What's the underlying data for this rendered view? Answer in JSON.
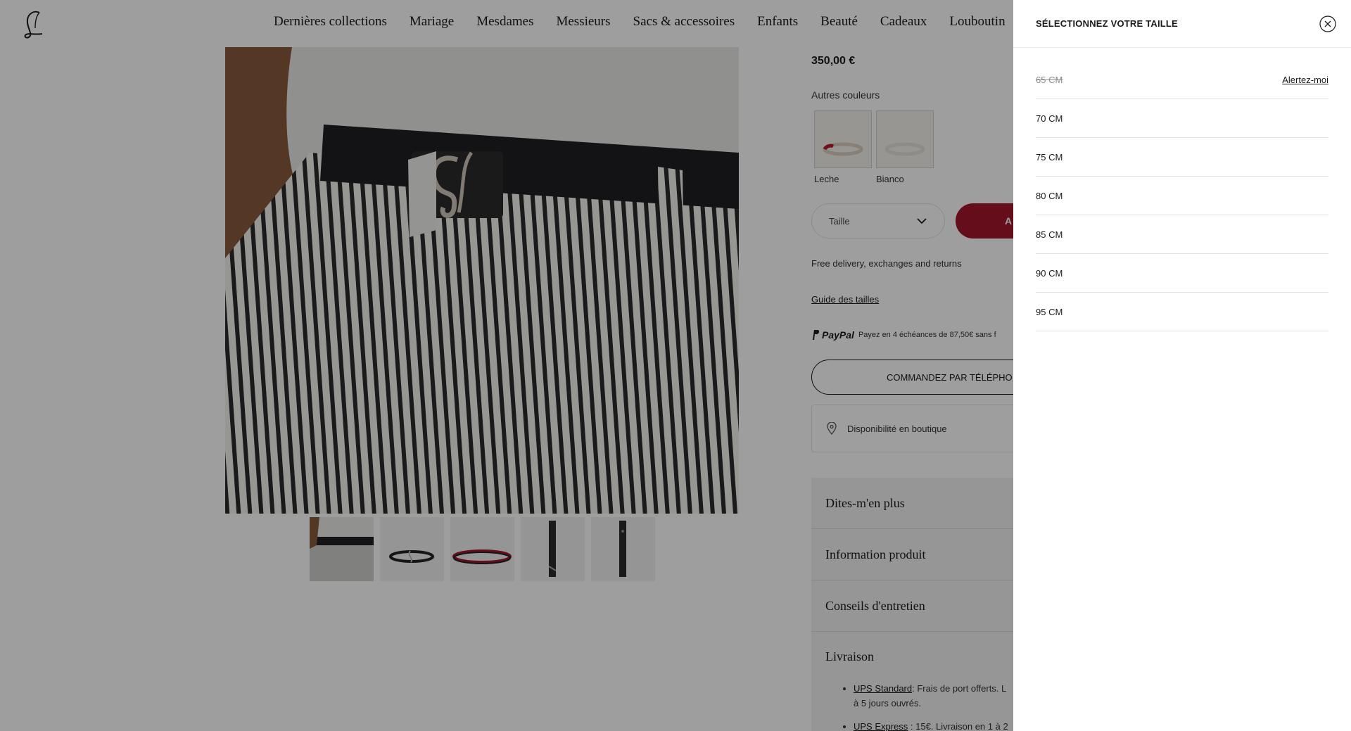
{
  "header": {
    "nav": [
      "Dernières collections",
      "Mariage",
      "Mesdames",
      "Messieurs",
      "Sacs & accessoires",
      "Enfants",
      "Beauté",
      "Cadeaux",
      "Louboutin"
    ]
  },
  "product": {
    "price": "350,00 €",
    "other_colors_label": "Autres couleurs",
    "swatches": [
      {
        "label": "Leche"
      },
      {
        "label": "Bianco"
      }
    ],
    "size_placeholder": "Taille",
    "add_to_cart_label": "A",
    "free_delivery": "Free delivery, exchanges and returns",
    "size_guide": "Guide des tailles",
    "paypal_brand": "PayPal",
    "paypal_text": "Payez en 4 échéances de 87,50€ sans f",
    "phone_order": "COMMANDEZ PAR TÉLÉPHO",
    "store_availability": "Disponibilité en boutique"
  },
  "accordion": {
    "items": [
      "Dites-m'en plus",
      "Information produit",
      "Conseils d'entretien"
    ],
    "delivery_title": "Livraison",
    "delivery_items": [
      {
        "link": "UPS Standard",
        "text": ": Frais de port offerts. L",
        "text2": "à 5 jours ouvrés."
      },
      {
        "link": "UPS Express",
        "text": " : 15€. Livraison en 1 à 2"
      }
    ]
  },
  "size_drawer": {
    "title": "SÉLECTIONNEZ VOTRE TAILLE",
    "sizes": [
      {
        "label": "65 CM",
        "available": false,
        "action": "Alertez-moi"
      },
      {
        "label": "70 CM",
        "available": true
      },
      {
        "label": "75 CM",
        "available": true
      },
      {
        "label": "80 CM",
        "available": true
      },
      {
        "label": "85 CM",
        "available": true
      },
      {
        "label": "90 CM",
        "available": true
      },
      {
        "label": "95 CM",
        "available": true
      }
    ]
  },
  "colors": {
    "accent_red": "#a3162c",
    "overlay": "rgba(0,0,0,0.38)"
  }
}
